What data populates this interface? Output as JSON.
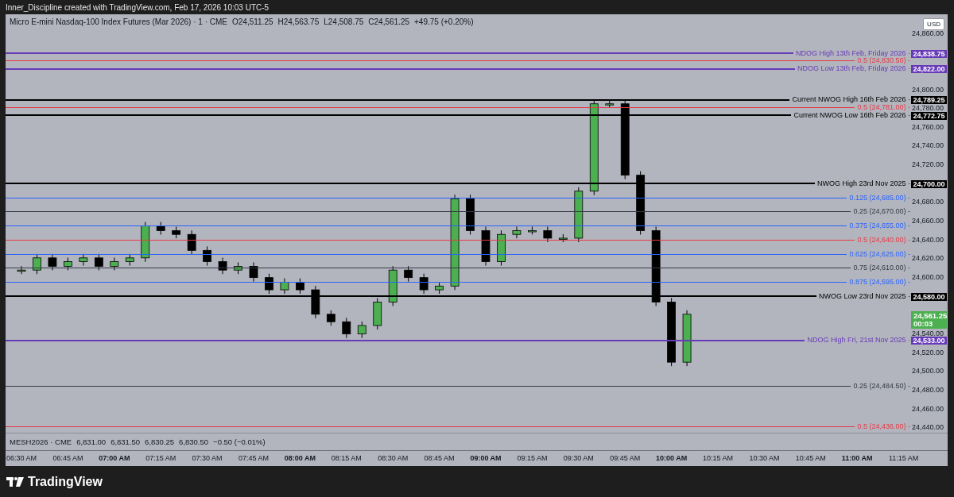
{
  "header": {
    "caption": "Inner_Discipline created with TradingView.com, Feb 17, 2026 10:03 UTC-5"
  },
  "legend": {
    "title": "Micro E-mini Nasdaq-100 Index Futures (Mar 2026) · 1 · CME",
    "values": [
      "O24,511.25",
      "H24,563.75",
      "L24,508.75",
      "C24,561.25",
      "+49.75 (+0.20%)"
    ]
  },
  "currency_button": "USD",
  "levels": [
    {
      "kind": "tagged",
      "label": "NDOG High 13th Feb, Friday 2026 ·",
      "tag": "24,838.75",
      "color": "#673ab7"
    },
    {
      "kind": "fib",
      "label": "0.5 (24,830.50) -",
      "color": "#e53945"
    },
    {
      "kind": "tagged",
      "label": "NDOG Low 13th Feb, Friday 2026 ·",
      "tag": "24,822.00",
      "color": "#673ab7"
    },
    {
      "kind": "tagged",
      "label": "Current NWOG High 16th Feb 2026 ·",
      "tag": "24,789.25",
      "color": "#000000"
    },
    {
      "kind": "fib",
      "label": "0.5 (24,781.00) -",
      "color": "#e53945"
    },
    {
      "kind": "tagged",
      "label": "Current NWOG Low 16th Feb 2026 ·",
      "tag": "24,772.75",
      "color": "#000000"
    },
    {
      "kind": "tagged",
      "label": "NWOG High 23rd Nov 2025 ·",
      "tag": "24,700.00",
      "color": "#000000"
    },
    {
      "kind": "fib",
      "label": "0.125 (24,685.00) -",
      "color": "#2962ff"
    },
    {
      "kind": "fib",
      "label": "0.25 (24,670.00) -",
      "color": "#363a45"
    },
    {
      "kind": "fib",
      "label": "0.375 (24,655.00) -",
      "color": "#2962ff"
    },
    {
      "kind": "fib",
      "label": "0.5 (24,640.00) -",
      "color": "#e53945"
    },
    {
      "kind": "fib",
      "label": "0.625 (24,625.00) -",
      "color": "#2962ff"
    },
    {
      "kind": "fib",
      "label": "0.75 (24,610.00) -",
      "color": "#363a45"
    },
    {
      "kind": "fib",
      "label": "0.875 (24,595.00) -",
      "color": "#2962ff"
    },
    {
      "kind": "tagged",
      "label": "NWOG Low 23rd Nov 2025 ·",
      "tag": "24,580.00",
      "color": "#000000"
    },
    {
      "kind": "tagged",
      "label": "NDOG High Fri, 21st Nov 2025 ·",
      "tag": "24,533.00",
      "color": "#673ab7"
    },
    {
      "kind": "fib",
      "label": "0.25 (24,484.50) -",
      "color": "#363a45"
    },
    {
      "kind": "fib",
      "label": "0.5 (24,436.00) -",
      "color": "#e53945"
    }
  ],
  "current_price": {
    "price": "24,561.25",
    "countdown": "00:03"
  },
  "price_axis": [
    "24,860.00",
    "24,800.00",
    "24,780.00",
    "24,760.00",
    "24,740.00",
    "24,720.00",
    "24,680.00",
    "24,660.00",
    "24,640.00",
    "24,620.00",
    "24,600.00",
    "24,540.00",
    "24,520.00",
    "24,500.00",
    "24,480.00",
    "24,460.00",
    "24,440.00"
  ],
  "lower_pane": {
    "symbol": "MESH2026 · CME",
    "values": [
      "6,831.00",
      "6,831.50",
      "6,830.25",
      "6,830.50",
      "−0.50 (−0.01%)"
    ]
  },
  "time_axis": [
    {
      "label": "06:30 AM",
      "major": false
    },
    {
      "label": "06:45 AM",
      "major": false
    },
    {
      "label": "07:00 AM",
      "major": true
    },
    {
      "label": "07:15 AM",
      "major": false
    },
    {
      "label": "07:30 AM",
      "major": false
    },
    {
      "label": "07:45 AM",
      "major": false
    },
    {
      "label": "08:00 AM",
      "major": true
    },
    {
      "label": "08:15 AM",
      "major": false
    },
    {
      "label": "08:30 AM",
      "major": false
    },
    {
      "label": "08:45 AM",
      "major": false
    },
    {
      "label": "09:00 AM",
      "major": true
    },
    {
      "label": "09:15 AM",
      "major": false
    },
    {
      "label": "09:30 AM",
      "major": false
    },
    {
      "label": "09:45 AM",
      "major": false
    },
    {
      "label": "10:00 AM",
      "major": true
    },
    {
      "label": "10:15 AM",
      "major": false
    },
    {
      "label": "10:30 AM",
      "major": false
    },
    {
      "label": "10:45 AM",
      "major": false
    },
    {
      "label": "11:00 AM",
      "major": true
    },
    {
      "label": "11:15 AM",
      "major": false
    }
  ],
  "footer": {
    "brand": "TradingView"
  }
}
